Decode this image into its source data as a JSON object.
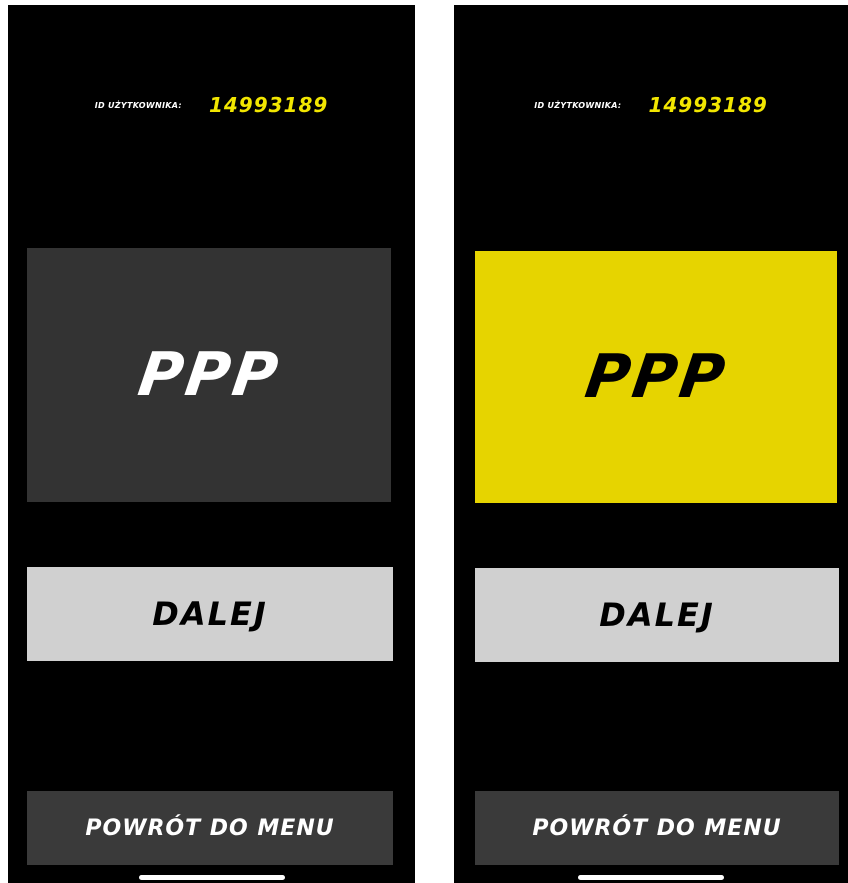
{
  "screens": [
    {
      "user_label": "ID UŻYTKOWNIKA:",
      "user_id": "14993189",
      "choice_label": "PPP",
      "next_label": "DALEJ",
      "menu_label": "POWRÓT DO MENU",
      "choice_state": "unselected"
    },
    {
      "user_label": "ID UŻYTKOWNIKA:",
      "user_id": "14993189",
      "choice_label": "PPP",
      "next_label": "DALEJ",
      "menu_label": "POWRÓT DO MENU",
      "choice_state": "selected"
    }
  ],
  "colors": {
    "background": "#000000",
    "accent_yellow": "#e6d400",
    "user_id_yellow": "#f2e600",
    "tile_unselected": "#333333",
    "next_button": "#d0d0d0",
    "menu_button": "#3a3a3a"
  }
}
